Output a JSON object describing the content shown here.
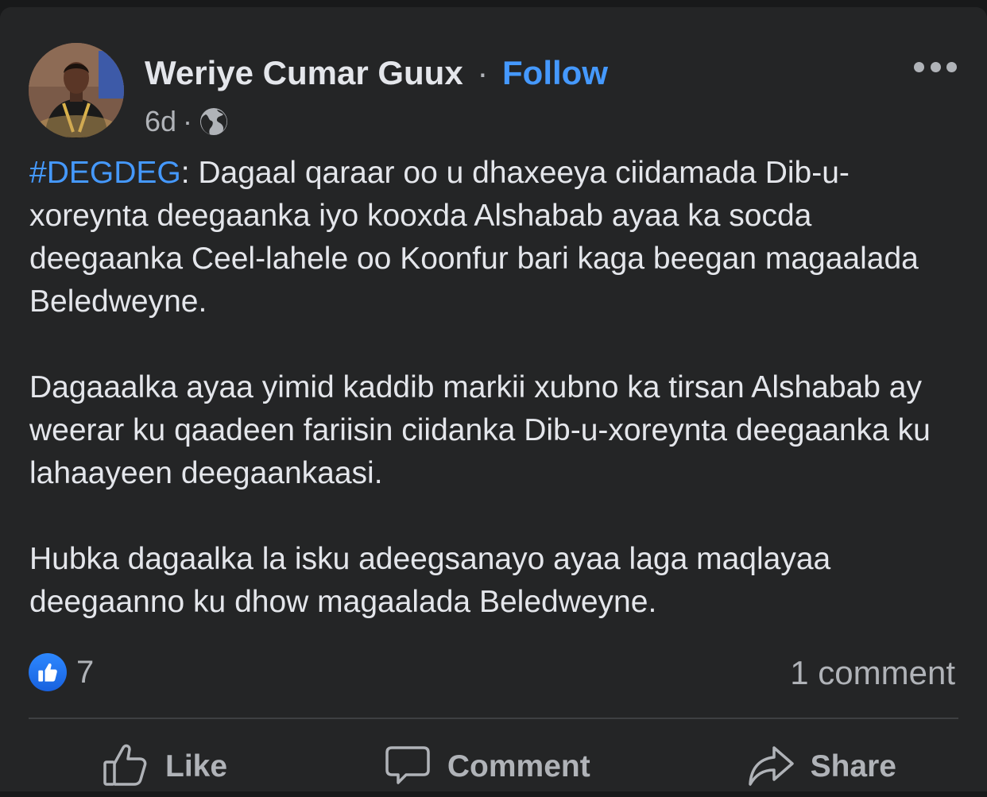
{
  "post": {
    "author": "Weriye Cumar Guux",
    "separator": "·",
    "follow_label": "Follow",
    "time": "6d",
    "time_separator": "·",
    "audience_icon": "globe-icon",
    "more_icon": "more-options-icon",
    "hashtag": "#DEGDEG",
    "paragraph1_rest": ": Dagaal qaraar oo u dhaxeeya ciidamada Dib-u-xoreynta deegaanka iyo kooxda Alshabab ayaa ka socda deegaanka Ceel-lahele oo Koonfur bari kaga beegan magaalada Beledweyne.",
    "paragraph2": "Dagaaalka ayaa yimid kaddib markii xubno ka tirsan Alshabab ay weerar ku qaadeen fariisin  ciidanka Dib-u-xoreynta deegaanka ku lahaayeen deegaankaasi.",
    "paragraph3": "Hubka dagaalka la isku adeegsanayo ayaa laga maqlayaa deegaanno ku dhow magaalada Beledweyne."
  },
  "stats": {
    "reaction_icon": "like-reaction-icon",
    "reaction_count": "7",
    "comment_count": "1 comment"
  },
  "actions": {
    "like": "Like",
    "comment": "Comment",
    "share": "Share"
  },
  "colors": {
    "background": "#242526",
    "text": "#e4e6eb",
    "secondary_text": "#b0b3b8",
    "link": "#4599ff"
  }
}
